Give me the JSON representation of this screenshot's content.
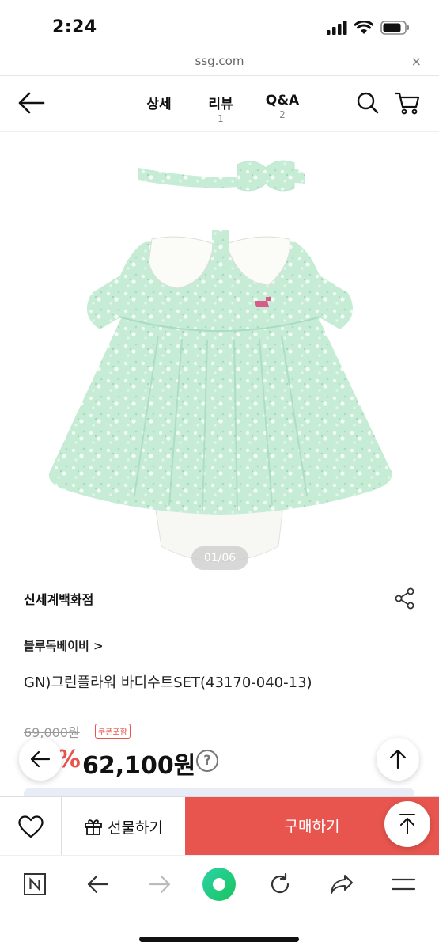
{
  "status_bar": {
    "time": "2:24"
  },
  "url_bar": {
    "url": "ssg.com",
    "close_glyph": "×"
  },
  "header": {
    "tabs": [
      {
        "label": "상세",
        "count": ""
      },
      {
        "label": "리뷰",
        "count": "1"
      },
      {
        "label": "Q&A",
        "count": "2"
      }
    ]
  },
  "gallery": {
    "counter": "01/06"
  },
  "store": {
    "name": "신세계백화점"
  },
  "product": {
    "brand": "블루독베이비 >",
    "title": "GN)그린플라워 바디수트SET(43170-040-13)",
    "original_price": "69,000원",
    "coupon_badge": "쿠폰포함",
    "discount_percent": "10%",
    "sale_price": "62,100원",
    "info_glyph": "?"
  },
  "purchase_bar": {
    "gift_label": "선물하기",
    "buy_label": "구매하기"
  },
  "colors": {
    "accent_red": "#e8554e",
    "mint_fabric": "#c6ecd6",
    "text_dark": "#111111"
  },
  "icons": {
    "back": "arrow-left-icon",
    "search": "search-icon",
    "cart": "cart-icon",
    "share": "share-icon",
    "wish": "heart-icon",
    "gift": "gift-icon",
    "scroll_top": "arrow-up-icon"
  }
}
